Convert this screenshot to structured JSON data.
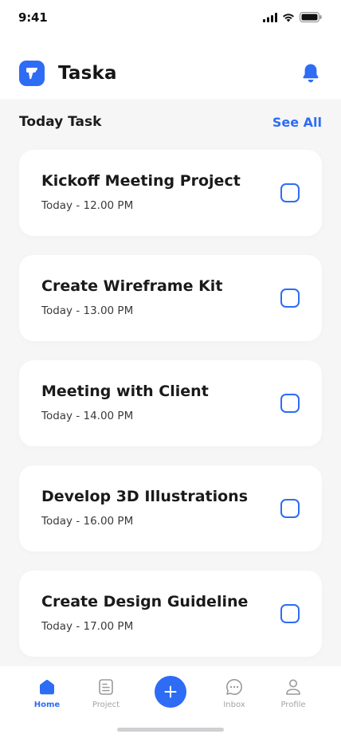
{
  "status_bar": {
    "time": "9:41",
    "icons": [
      "cellular-signal-icon",
      "wifi-icon",
      "battery-icon"
    ]
  },
  "header": {
    "logo_icon": "taska-logo-icon",
    "app_name": "Taska",
    "notification_icon": "bell-icon"
  },
  "today_section": {
    "title": "Today Task",
    "see_all_label": "See All"
  },
  "tasks": [
    {
      "title": "Kickoff Meeting Project",
      "time": "Today - 12.00 PM",
      "checked": false
    },
    {
      "title": "Create Wireframe Kit",
      "time": "Today - 13.00 PM",
      "checked": false
    },
    {
      "title": "Meeting with Client",
      "time": "Today - 14.00 PM",
      "checked": false
    },
    {
      "title": "Develop 3D Illustrations",
      "time": "Today - 16.00 PM",
      "checked": false
    },
    {
      "title": "Create Design Guideline",
      "time": "Today - 17.00 PM",
      "checked": false
    }
  ],
  "bottom_nav": {
    "items": [
      {
        "label": "Home",
        "icon": "home-icon",
        "active": true
      },
      {
        "label": "Project",
        "icon": "document-icon",
        "active": false
      },
      {
        "label": "Inbox",
        "icon": "chat-bubble-icon",
        "active": false
      },
      {
        "label": "Profile",
        "icon": "user-icon",
        "active": false
      }
    ],
    "add_icon": "plus-icon"
  },
  "colors": {
    "accent": "#2e6cf5",
    "background": "#f6f6f7",
    "card": "#ffffff",
    "text_primary": "#1a1a1a",
    "nav_inactive": "#a3a3a3"
  }
}
